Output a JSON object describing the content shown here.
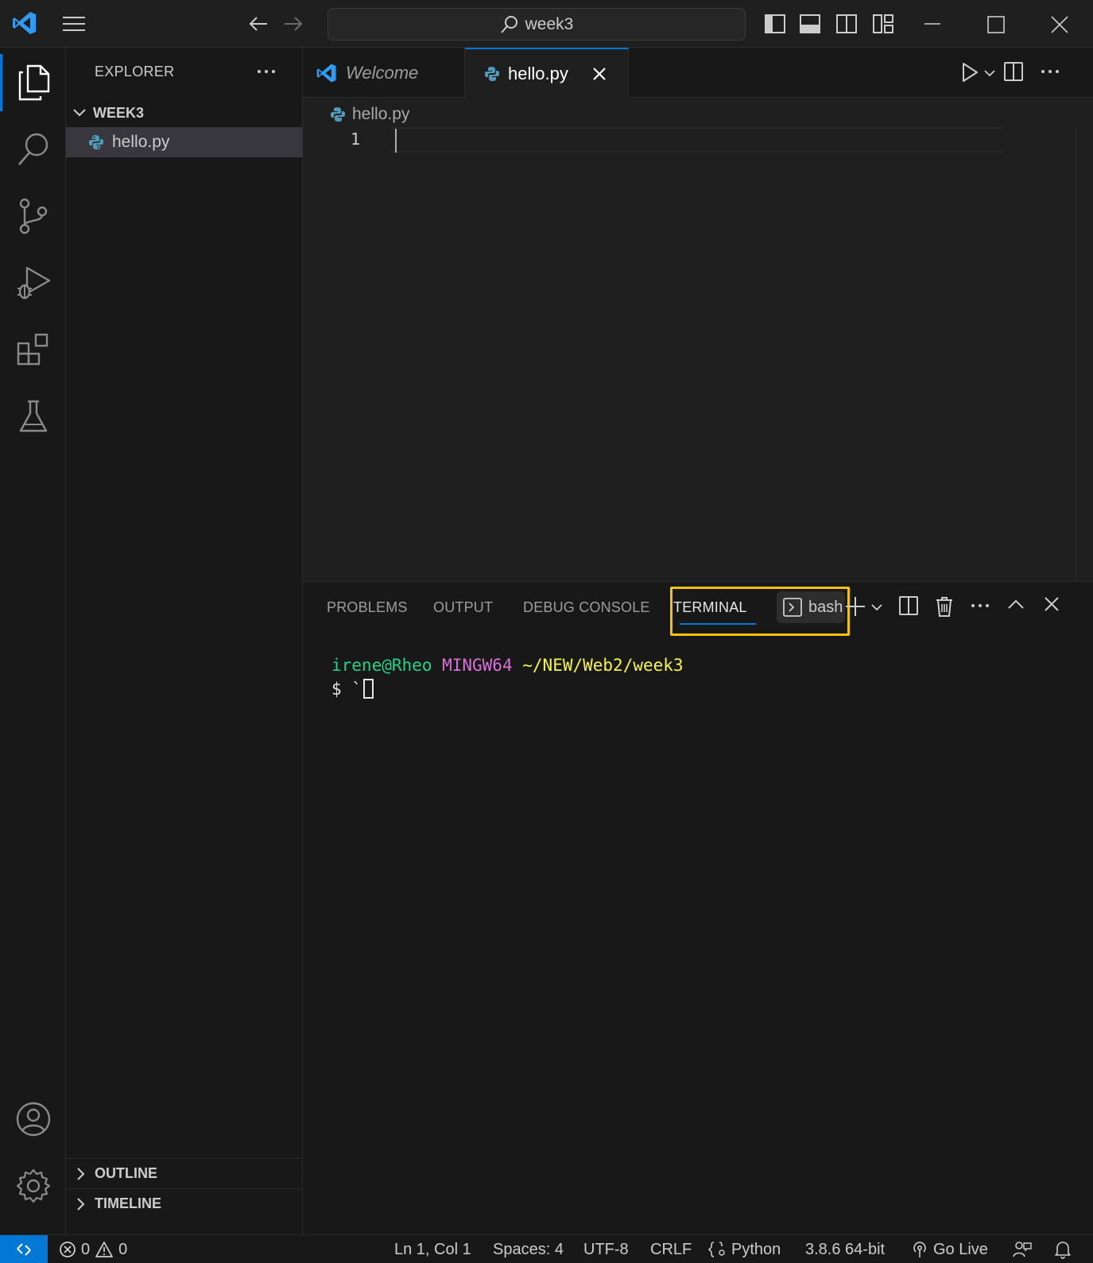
{
  "titlebar": {
    "search_text": "week3"
  },
  "sidebar": {
    "title": "EXPLORER",
    "folder": "WEEK3",
    "files": [
      "hello.py"
    ],
    "sections": [
      "OUTLINE",
      "TIMELINE"
    ]
  },
  "tabs": {
    "welcome": "Welcome",
    "active": "hello.py"
  },
  "editor": {
    "breadcrumb": "hello.py",
    "line_number": "1"
  },
  "panel": {
    "tabs": [
      "PROBLEMS",
      "OUTPUT",
      "DEBUG CONSOLE",
      "TERMINAL"
    ],
    "active_tab": "TERMINAL",
    "shell": "bash",
    "terminal": {
      "user": "irene@Rheo",
      "system": "MINGW64",
      "path": "~/NEW/Web2/week3",
      "prompt": "$ `"
    }
  },
  "statusbar": {
    "errors": "0",
    "warnings": "0",
    "position": "Ln 1, Col 1",
    "spaces": "Spaces: 4",
    "encoding": "UTF-8",
    "eol": "CRLF",
    "language": "Python",
    "interpreter": "3.8.6 64-bit",
    "golive": "Go Live"
  },
  "colors": {
    "accent": "#0078d4",
    "highlight_box": "#f5c400",
    "python_icon": "#519aba",
    "vscode_logo": "#2f9cf4"
  }
}
